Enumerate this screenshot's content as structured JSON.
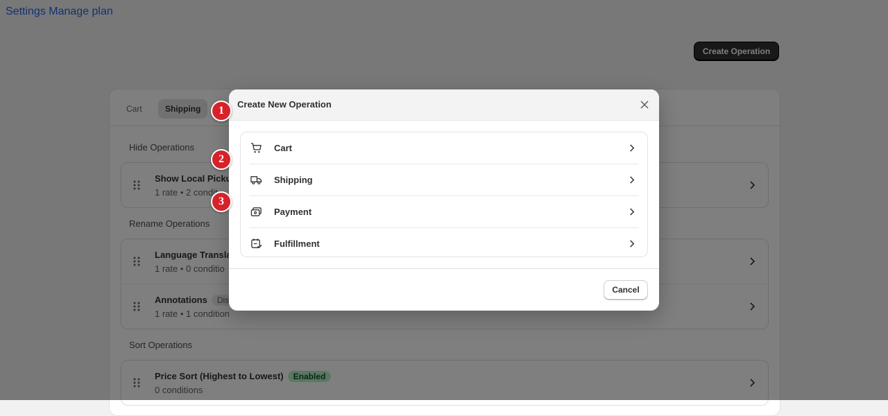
{
  "nav": {
    "settings": "Settings",
    "manage_plan": "Manage plan"
  },
  "header": {
    "create_operation": "Create Operation"
  },
  "tabs": [
    {
      "label": "Cart"
    },
    {
      "label": "Shipping",
      "active": true
    }
  ],
  "sections": {
    "hide": {
      "title": "Hide Operations",
      "rows": [
        {
          "title": "Show Local Picku",
          "rate": "1 rate",
          "conditions": "2 condit"
        }
      ]
    },
    "rename": {
      "title": "Rename Operations",
      "rows": [
        {
          "title": "Language Transla",
          "rate": "1 rate",
          "conditions": "0 conditio"
        },
        {
          "title": "Annotations",
          "badge": "Dis",
          "rate": "1 rate",
          "conditions": "1 condition"
        }
      ]
    },
    "sort": {
      "title": "Sort Operations",
      "rows": [
        {
          "title": "Price Sort (Highest to Lowest)",
          "badge": "Enabled",
          "rate": "",
          "conditions": "0 conditions"
        }
      ]
    }
  },
  "modal": {
    "title": "Create New Operation",
    "items": [
      {
        "label": "Cart",
        "icon": "cart-icon"
      },
      {
        "label": "Shipping",
        "icon": "truck-icon"
      },
      {
        "label": "Payment",
        "icon": "payment-icon"
      },
      {
        "label": "Fulfillment",
        "icon": "fulfillment-icon"
      }
    ],
    "cancel": "Cancel"
  },
  "markers": [
    "1",
    "2",
    "3"
  ],
  "colors": {
    "accent_link": "#2463eb",
    "primary_button": "#303030",
    "marker": "#d6222a",
    "badge_enabled": "#b6eec4"
  }
}
